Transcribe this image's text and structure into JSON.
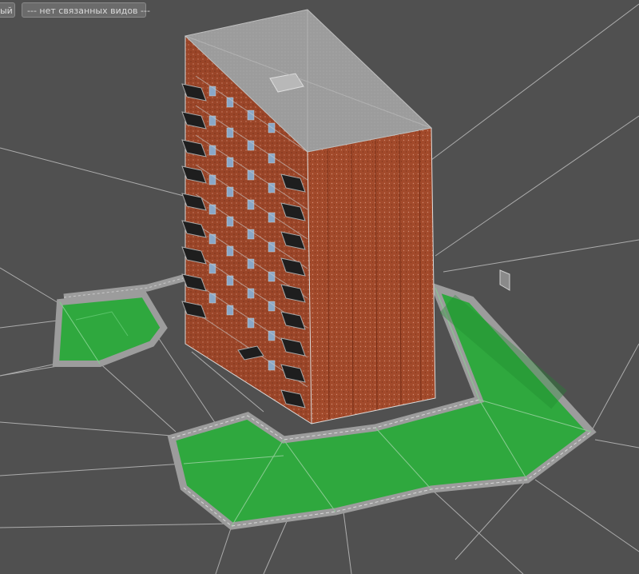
{
  "viewport_tabs": {
    "left_label": "ый",
    "linked_views_label": "--- нет связанных видов ---"
  },
  "scene": {
    "background_color": "#505050",
    "building_facade_color": "#a24a2b",
    "roof_color": "#9a9a9a",
    "ground_color": "#2fa83e",
    "fence_color": "#9c9c9c",
    "mesh_line_color": "#c8c8c8",
    "window_color": "#8aa8c8",
    "ac_unit_color": "#1e1e1e"
  }
}
